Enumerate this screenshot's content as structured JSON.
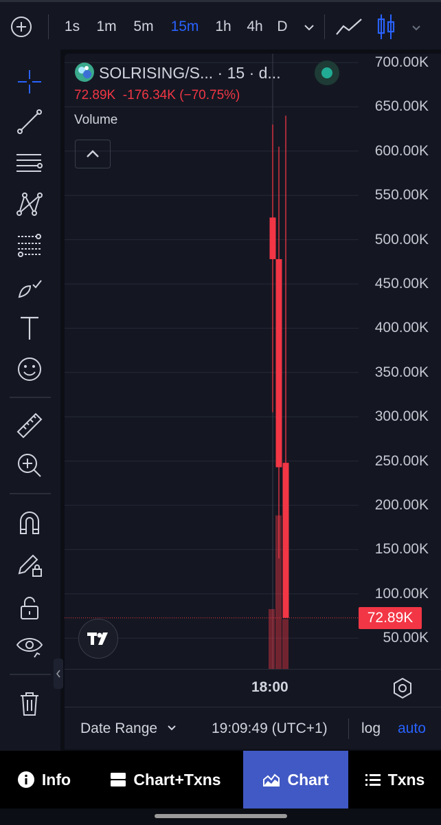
{
  "toolbar": {
    "intervals": [
      {
        "label": "1s",
        "active": false
      },
      {
        "label": "1m",
        "active": false
      },
      {
        "label": "5m",
        "active": false
      },
      {
        "label": "15m",
        "active": true
      },
      {
        "label": "1h",
        "active": false
      },
      {
        "label": "4h",
        "active": false
      },
      {
        "label": "D",
        "active": false
      }
    ]
  },
  "legend": {
    "title": "SOLRISING/S... · 15 · d...",
    "last": "72.89K",
    "change": "-176.34K (−70.75%)",
    "volume_label": "Volume"
  },
  "price_axis": {
    "ticks": [
      "700.00K",
      "650.00K",
      "600.00K",
      "550.00K",
      "500.00K",
      "450.00K",
      "400.00K",
      "350.00K",
      "300.00K",
      "250.00K",
      "200.00K",
      "150.00K",
      "100.00K",
      "50.00K"
    ],
    "current_price": "72.89K"
  },
  "time_axis": {
    "ticks": [
      "18:00"
    ]
  },
  "bottom_controls": {
    "date_range": "Date Range",
    "time": "19:09:49 (UTC+1)",
    "log": "log",
    "auto": "auto"
  },
  "nav": {
    "info": "Info",
    "chart_txns": "Chart+Txns",
    "chart": "Chart",
    "txns": "Txns"
  },
  "colors": {
    "down": "#f23645",
    "accent": "#2962ff",
    "up": "#22ab94"
  },
  "chart_data": {
    "type": "candlestick",
    "ylim": [
      0,
      700000
    ],
    "candles": [
      {
        "open": 525000,
        "close": 478000,
        "high": 630000,
        "low": 305000
      },
      {
        "open": 478000,
        "close": 243000,
        "high": 605000,
        "low": 140000
      },
      {
        "open": 248000,
        "close": 72890,
        "high": 640000,
        "low": 72890
      }
    ],
    "volume_levels": [
      0.3,
      0.77,
      0.25
    ]
  }
}
